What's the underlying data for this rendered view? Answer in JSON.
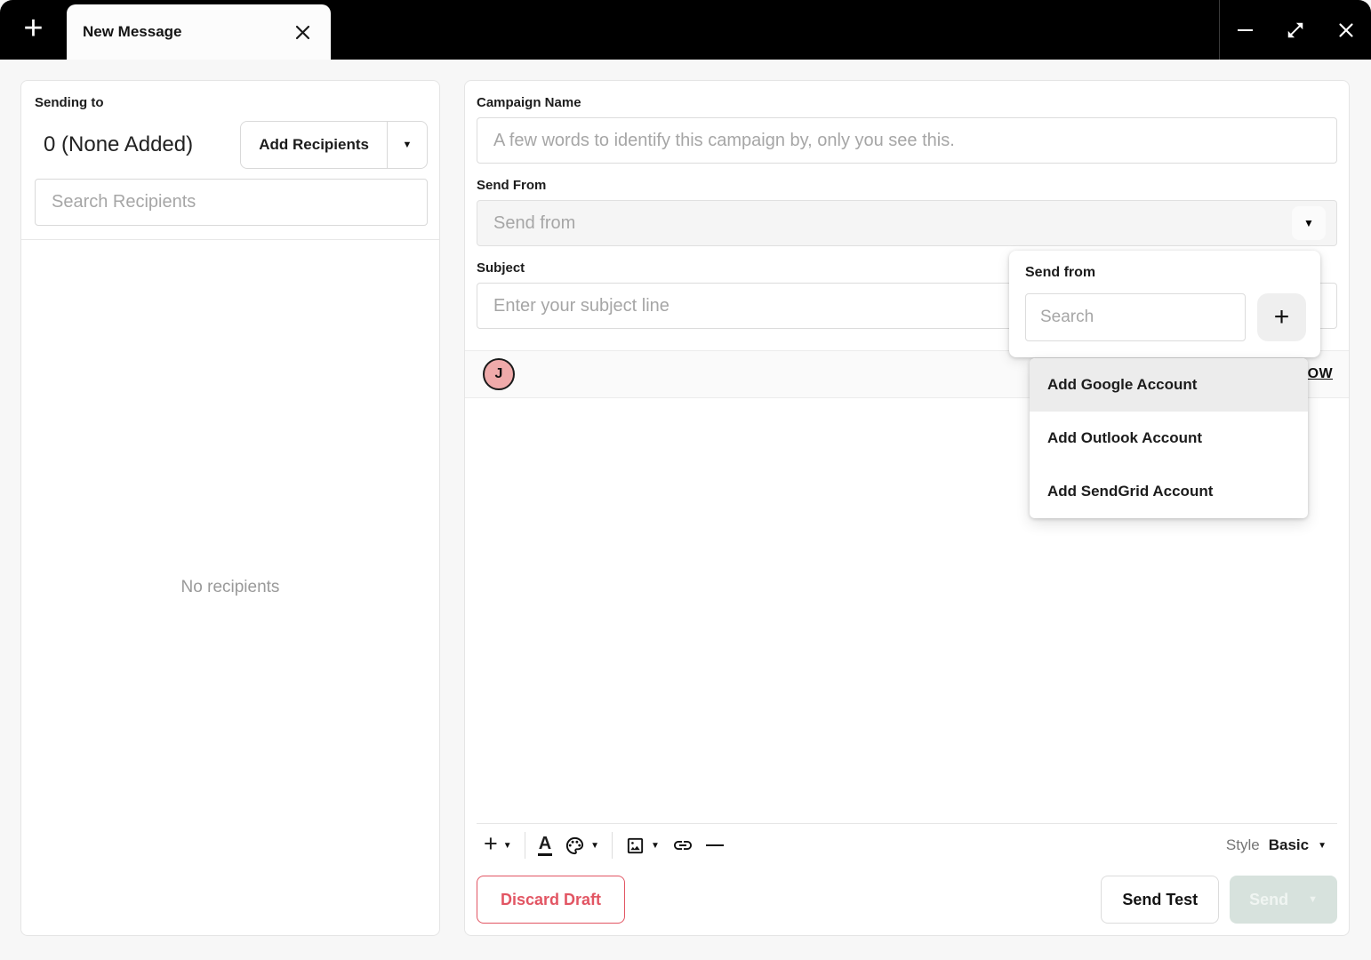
{
  "window": {
    "tab_title": "New Message",
    "icons": {
      "new_tab_plus": "+",
      "caret_down": "▼",
      "small_caret": "▼"
    }
  },
  "recipients_panel": {
    "heading": "Sending to",
    "count_text": "0 (None Added)",
    "add_button_label": "Add Recipients",
    "search_placeholder": "Search Recipients",
    "empty_text": "No recipients"
  },
  "compose": {
    "campaign_label": "Campaign Name",
    "campaign_placeholder": "A few words to identify this campaign by, only you see this.",
    "send_from_label": "Send From",
    "send_from_placeholder": "Send from",
    "subject_label": "Subject",
    "subject_placeholder": "Enter your subject line",
    "avatar_initial": "J",
    "row_link_text": "OW",
    "toolbar_plus": "+",
    "style_label": "Style",
    "style_value": "Basic"
  },
  "send_from_popup": {
    "title": "Send from",
    "search_placeholder": "Search",
    "add_button": "+",
    "items": [
      {
        "label": "Add Google Account"
      },
      {
        "label": "Add Outlook Account"
      },
      {
        "label": "Add SendGrid Account"
      }
    ]
  },
  "footer": {
    "discard_label": "Discard Draft",
    "send_test_label": "Send Test",
    "send_label": "Send"
  },
  "colors": {
    "accent_red": "#e25563",
    "send_disabled_bg": "#d7e2dd",
    "avatar_bg": "#efaaaa",
    "menu_highlight": "#ececec"
  }
}
